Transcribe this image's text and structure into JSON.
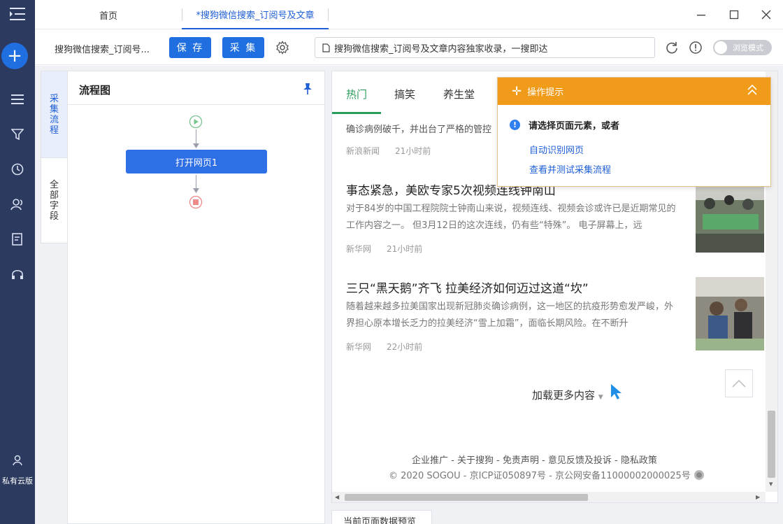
{
  "sidebar": {
    "menu_icon": "menu-icon",
    "add_icon": "plus-icon",
    "add_symbol": "+",
    "items": [
      {
        "name": "list-icon"
      },
      {
        "name": "filter-icon"
      },
      {
        "name": "clock-icon"
      },
      {
        "name": "users-icon"
      },
      {
        "name": "document-icon"
      },
      {
        "name": "headset-icon"
      }
    ],
    "private_cloud_label": "私有云版"
  },
  "titlebar": {
    "home_tab": "首页",
    "active_tab": "*搜狗微信搜索_订阅号及文章",
    "window_controls": [
      "minimize-icon",
      "maximize-icon",
      "close-icon"
    ]
  },
  "toolbar": {
    "task_name": "搜狗微信搜索_订阅号...",
    "save_label": "保 存",
    "collect_label": "采 集",
    "url_text": "搜狗微信搜索_订阅号及文章内容独家收录，一搜即达",
    "browse_mode_label": "浏览模式"
  },
  "vtabs": {
    "collect_flow": [
      "采",
      "集",
      "流",
      "程"
    ],
    "all_fields": [
      "全",
      "部",
      "字",
      "段"
    ]
  },
  "flow": {
    "title": "流程图",
    "node_label": "打开网页1"
  },
  "news": {
    "tabs": [
      "热门",
      "搞笑",
      "养生堂"
    ],
    "fragment_text": "确诊病例破千，并出台了严格的管控",
    "items": [
      {
        "source": "新浪新闻",
        "time": "21小时前"
      },
      {
        "headline": "事态紧急，美欧专家5次视频连线钟南山",
        "summary": "对于84岁的中国工程院院士钟南山来说，视频连线、视频会诊或许已是近期常见的工作内容之一。 但3月12日的这次连线，仍有些“特殊”。 电子屏幕上，远",
        "source": "新华网",
        "time": "21小时前"
      },
      {
        "headline": "三只“黑天鹅”齐飞 拉美经济如何迈过这道“坎”",
        "summary": "随着越来越多拉美国家出现新冠肺炎确诊病例，这一地区的抗疫形势愈发严峻，外界担心原本增长乏力的拉美经济“雪上加霜”，面临长期风险。在不断升",
        "source": "新华网",
        "time": "22小时前"
      }
    ],
    "load_more": "加载更多内容",
    "footer_links": "企业推广 -  关于搜狗 -  免责声明 -  意见反馈及投诉 -  隐私政策",
    "footer_copy": "© 2020 SOGOU -  京ICP证050897号 -  京公网安备11000002000025号"
  },
  "tip": {
    "title": "操作提示",
    "message": "请选择页面元素，或者",
    "link_auto": "自动识别网页",
    "link_test": "查看并测试采集流程"
  },
  "preview_tab": "当前页面数据预览",
  "colors": {
    "sidebar_bg": "#2b3a5e",
    "primary": "#1f6fe0",
    "tip_orange": "#f19b1a",
    "news_green": "#2a9d5c"
  }
}
